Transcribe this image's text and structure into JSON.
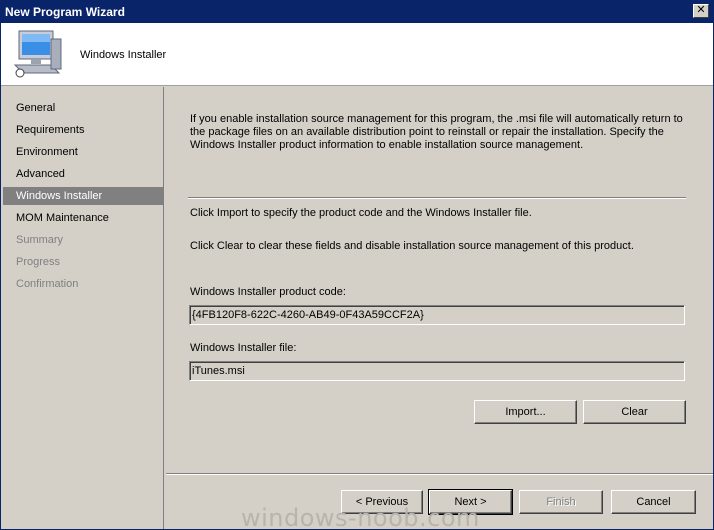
{
  "window": {
    "title": "New Program Wizard",
    "close_glyph": "✕"
  },
  "banner": {
    "title": "Windows Installer",
    "icon": "computer-icon"
  },
  "nav": {
    "items": [
      {
        "label": "General",
        "state": "normal"
      },
      {
        "label": "Requirements",
        "state": "normal"
      },
      {
        "label": "Environment",
        "state": "normal"
      },
      {
        "label": "Advanced",
        "state": "normal"
      },
      {
        "label": "Windows Installer",
        "state": "selected"
      },
      {
        "label": "MOM Maintenance",
        "state": "normal"
      },
      {
        "label": "Summary",
        "state": "disabled"
      },
      {
        "label": "Progress",
        "state": "disabled"
      },
      {
        "label": "Confirmation",
        "state": "disabled"
      }
    ]
  },
  "main": {
    "intro": "If you enable installation source management for this program, the .msi file will automatically return to the package files on an available distribution point to reinstall or repair the installation. Specify the Windows Installer product information to enable installation source management.",
    "import_hint": "Click Import to specify the product code and the Windows Installer file.",
    "clear_hint": "Click Clear to clear these fields and disable installation source management of this product.",
    "product_code_label": "Windows Installer product code:",
    "product_code_value": "{4FB120F8-622C-4260-AB49-0F43A59CCF2A}",
    "file_label": "Windows Installer file:",
    "file_value": "iTunes.msi",
    "import_button": "Import...",
    "clear_button": "Clear"
  },
  "footer": {
    "previous_button": "< Previous",
    "next_button": "Next >",
    "finish_button": "Finish",
    "cancel_button": "Cancel"
  },
  "watermark": "windows-noob.com",
  "colors": {
    "title_bar": "#0a246a",
    "selected_nav": "#808080",
    "face": "#d4d0c8"
  }
}
